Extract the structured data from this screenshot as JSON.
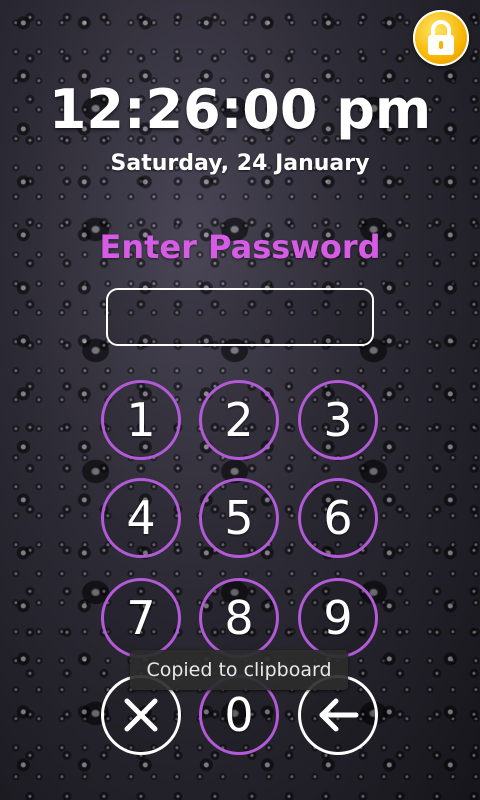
{
  "status": {
    "time": "12:26:00 pm",
    "date": "Saturday, 24 January"
  },
  "lock": {
    "prompt": "Enter Password",
    "password_value": "",
    "icon": "lock-icon"
  },
  "keypad": {
    "keys": [
      "1",
      "2",
      "3",
      "4",
      "5",
      "6",
      "7",
      "8",
      "9",
      "0"
    ],
    "clear_icon": "close-icon",
    "backspace_icon": "backspace-arrow-icon"
  },
  "toast": {
    "message": "Copied to clipboard"
  },
  "colors": {
    "accent": "#d65ce6",
    "ring": "#b25ad8",
    "lock_badge": "#f6b300"
  }
}
